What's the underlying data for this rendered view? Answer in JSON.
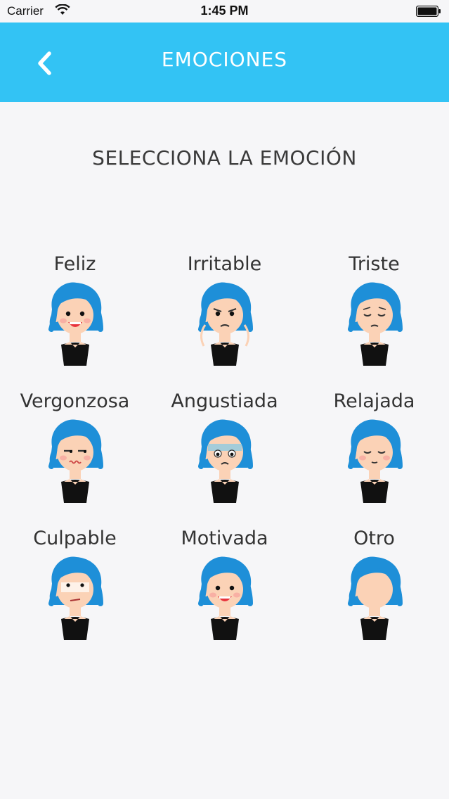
{
  "status_bar": {
    "carrier": "Carrier",
    "time": "1:45 PM"
  },
  "nav": {
    "title": "EMOCIONES",
    "back_icon": "chevron-left-icon"
  },
  "prompt": "SELECCIONA LA EMOCIÓN",
  "colors": {
    "accent": "#33c3f4",
    "hair": "#1e8fd8",
    "skin": "#fbd2b6",
    "shirt": "#111111",
    "background": "#f6f6f8"
  },
  "emotions": [
    {
      "label": "Feliz",
      "expression": "happy"
    },
    {
      "label": "Irritable",
      "expression": "irritable"
    },
    {
      "label": "Triste",
      "expression": "sad"
    },
    {
      "label": "Vergonzosa",
      "expression": "ashamed"
    },
    {
      "label": "Angustiada",
      "expression": "anguished"
    },
    {
      "label": "Relajada",
      "expression": "relaxed"
    },
    {
      "label": "Culpable",
      "expression": "guilty"
    },
    {
      "label": "Motivada",
      "expression": "motivated"
    },
    {
      "label": "Otro",
      "expression": "blank"
    }
  ]
}
